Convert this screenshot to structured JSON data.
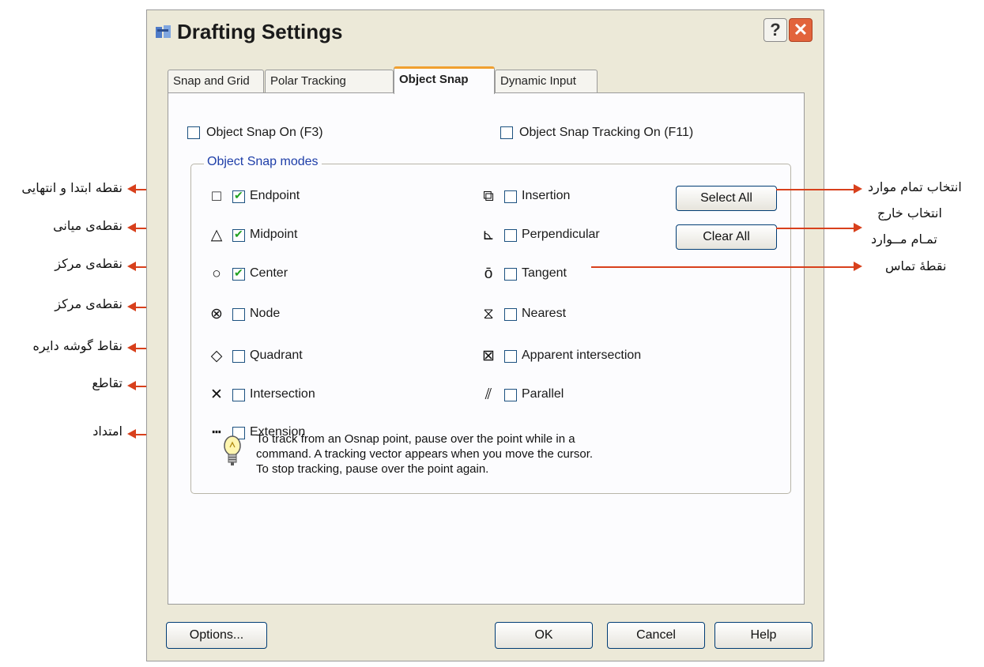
{
  "window": {
    "title": "Drafting Settings",
    "help_glyph": "?",
    "close_glyph": "✕"
  },
  "tabs": [
    {
      "label": "Snap and Grid"
    },
    {
      "label": "Polar Tracking"
    },
    {
      "label": "Object Snap",
      "active": true
    },
    {
      "label": "Dynamic Input"
    }
  ],
  "object_snap_on": {
    "label": "Object Snap On (F3)",
    "checked": false
  },
  "object_snap_tracking_on": {
    "label": "Object Snap Tracking On (F11)",
    "checked": false
  },
  "modes_group_title": "Object Snap modes",
  "modes_left": [
    {
      "label": "Endpoint",
      "checked": true,
      "icon": "square-icon",
      "glyph": "□"
    },
    {
      "label": "Midpoint",
      "checked": true,
      "icon": "triangle-icon",
      "glyph": "△"
    },
    {
      "label": "Center",
      "checked": true,
      "icon": "circle-icon",
      "glyph": "○"
    },
    {
      "label": "Node",
      "checked": false,
      "icon": "node-icon",
      "glyph": "⊗"
    },
    {
      "label": "Quadrant",
      "checked": false,
      "icon": "diamond-icon",
      "glyph": "◇"
    },
    {
      "label": "Intersection",
      "checked": false,
      "icon": "x-icon",
      "glyph": "✕"
    },
    {
      "label": "Extension",
      "checked": false,
      "icon": "extension-icon",
      "glyph": "┅"
    }
  ],
  "modes_right": [
    {
      "label": "Insertion",
      "checked": false,
      "icon": "insertion-icon",
      "glyph": "⧉"
    },
    {
      "label": "Perpendicular",
      "checked": false,
      "icon": "perpendicular-icon",
      "glyph": "⊾"
    },
    {
      "label": "Tangent",
      "checked": false,
      "icon": "tangent-icon",
      "glyph": "ō"
    },
    {
      "label": "Nearest",
      "checked": false,
      "icon": "nearest-icon",
      "glyph": "⧖"
    },
    {
      "label": "Apparent intersection",
      "checked": false,
      "icon": "apparent-intersection-icon",
      "glyph": "⊠"
    },
    {
      "label": "Parallel",
      "checked": false,
      "icon": "parallel-icon",
      "glyph": "⫽"
    }
  ],
  "buttons": {
    "select_all": "Select All",
    "clear_all": "Clear All",
    "options": "Options...",
    "ok": "OK",
    "cancel": "Cancel",
    "help": "Help"
  },
  "tip": {
    "icon": "lightbulb-icon",
    "lines": [
      "To track from an Osnap point, pause over the point while in a",
      "command.  A tracking vector appears when you move the cursor.",
      "To stop tracking, pause over the point again."
    ]
  },
  "annotations": {
    "left": [
      "نقطه ابتدا و انتهایی",
      "نقطه‌ی میانی",
      "نقطه‌ی مرکز",
      "نقطه‌ی مرکز",
      "نقاط گوشه دایره",
      "تقاطع",
      "امتداد"
    ],
    "select_all": "انتخاب تمام موارد",
    "clear_all_line1": "انتخاب خارج",
    "clear_all_line2": "تمـام مــوارد",
    "tangent": "نقطهٔ تماس"
  },
  "colors": {
    "annotation_line": "#d8401c",
    "group_title": "#1e3ea8",
    "check": "#21a121",
    "active_tab_accent": "#f0a030"
  }
}
